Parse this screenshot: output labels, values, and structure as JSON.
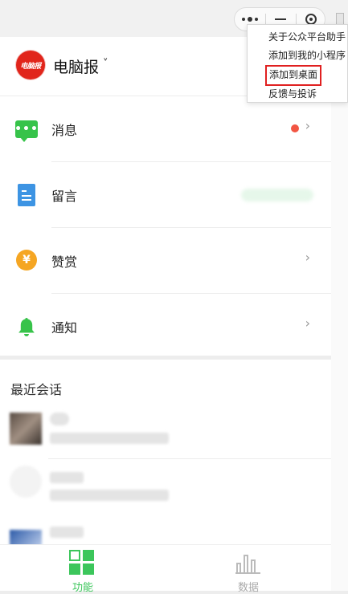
{
  "capsule": {
    "more_icon": "more-dots-icon",
    "minimize_icon": "minimize-icon",
    "close_icon": "target-close-icon"
  },
  "account": {
    "logo_text": "电脑报",
    "name": "电脑报",
    "caret": "˅"
  },
  "menu": {
    "items": [
      "关于公众平台助手",
      "添加到我的小程序",
      "添加到桌面",
      "反馈与投诉"
    ],
    "highlighted_index": 2,
    "highlight_color": "#e02020"
  },
  "functions": [
    {
      "label": "消息",
      "icon": "message-bubble-icon",
      "icon_text": "•••",
      "has_badge": true,
      "chevron": "›"
    },
    {
      "label": "留言",
      "icon": "note-icon",
      "chevron": ""
    },
    {
      "label": "赞赏",
      "icon": "coin-icon",
      "icon_text": "¥",
      "chevron": "›"
    },
    {
      "label": "通知",
      "icon": "bell-icon",
      "chevron": "›"
    }
  ],
  "recent": {
    "title": "最近会话"
  },
  "tabbar": {
    "tabs": [
      {
        "label": "功能",
        "icon": "grid-icon",
        "active": true,
        "color": "#3cc65b"
      },
      {
        "label": "数据",
        "icon": "bar-chart-icon",
        "active": false,
        "color": "#aaaaaa"
      }
    ]
  },
  "colors": {
    "accent_green": "#37c34a",
    "badge_red": "#f25643",
    "brand_red": "#e1251b"
  }
}
